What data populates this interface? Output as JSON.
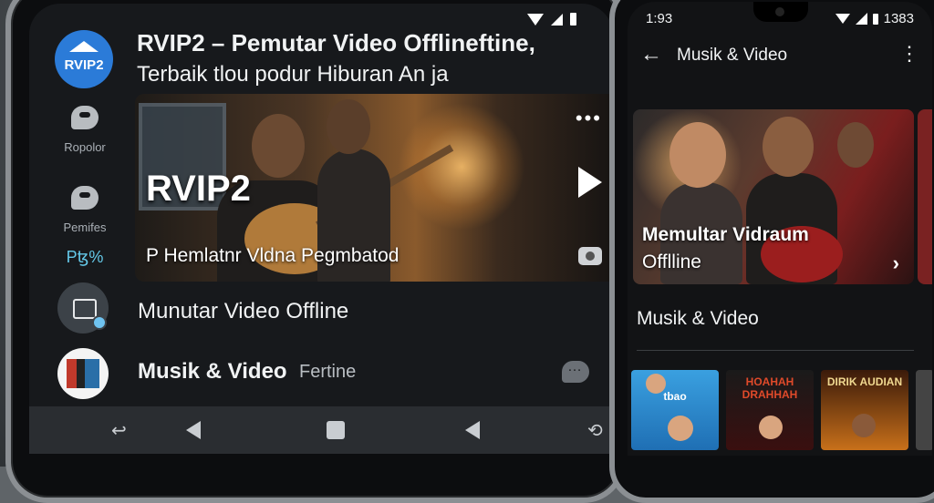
{
  "left_screen": {
    "app_title_line1": "RVIP2 – Pemutar Video Offlineftine,",
    "app_title_line2": "Terbaik tlou podur Hiburan An ja",
    "logo_text": "RVIP2",
    "side_items": [
      {
        "label": "Ropolor",
        "icon": "chat-bubble-icon"
      },
      {
        "label": "Pemifes",
        "icon": "chat-bubble-icon"
      }
    ],
    "side_percent": "Pꜩ%",
    "hero": {
      "brand": "RVIP2",
      "subtitle": "P Hemlatnr Vldna Pegmbatod",
      "more": "•••"
    },
    "rows": [
      {
        "label": "Munutar Video Offline",
        "icon": "offline-video-icon"
      },
      {
        "label": "Musik & Video",
        "sub": "Fertine",
        "icon": "music-video-icon"
      }
    ],
    "nav": {
      "back": "↩",
      "extra": "⟲"
    }
  },
  "right_screen": {
    "status": {
      "time": "1:93",
      "right": "1383"
    },
    "appbar": {
      "title": "Musik & Video",
      "back": "←",
      "more": "⋮"
    },
    "featured": {
      "title": "Memultar Vidraum",
      "subtitle": "Offlline",
      "arrow": "›"
    },
    "section_title": "Musik & Video",
    "thumbnails": [
      {
        "label": "tbao"
      },
      {
        "label": "HOAHAH DRAHHAH"
      },
      {
        "label": "DIRIK AUDIAN"
      }
    ]
  },
  "colors": {
    "accent_blue": "#2b7bd8",
    "percent_teal": "#64c8e8",
    "screen_bg": "#17191c"
  }
}
